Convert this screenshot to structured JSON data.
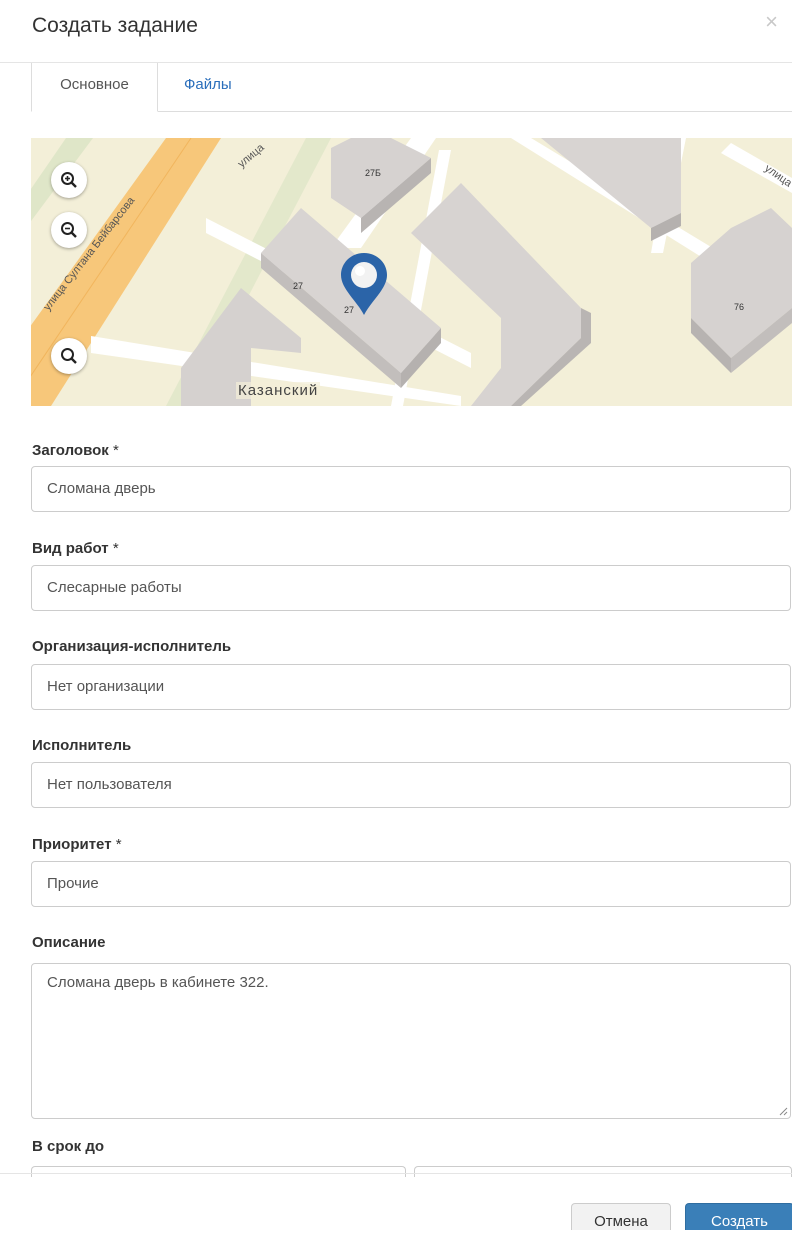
{
  "modal": {
    "title": "Создать задание",
    "close_glyph": "×"
  },
  "tabs": [
    {
      "label": "Основное"
    },
    {
      "label": "Файлы"
    }
  ],
  "map": {
    "road_label_1": "улица Султана Бейбарсова",
    "road_label_2": "улица",
    "road_label_3": "улица",
    "district_label": "Казанский",
    "house_numbers": [
      "27Б",
      "27",
      "27",
      "76"
    ],
    "controls": [
      "zoom-in-icon",
      "zoom-out-icon",
      "search-icon"
    ],
    "marker": "map-pin-icon"
  },
  "form": {
    "title": {
      "label": "Заголовок",
      "required": "*",
      "value": "Сломана дверь"
    },
    "work_type": {
      "label": "Вид работ",
      "required": "*",
      "value": "Слесарные работы"
    },
    "org": {
      "label": "Организация-исполнитель",
      "value": "Нет организации"
    },
    "executor": {
      "label": "Исполнитель",
      "value": "Нет пользователя"
    },
    "priority": {
      "label": "Приоритет",
      "required": "*",
      "value": "Прочие"
    },
    "description": {
      "label": "Описание",
      "value": "Сломана дверь в кабинете 322."
    },
    "deadline": {
      "label": "В срок до"
    }
  },
  "footer": {
    "cancel_label": "Отмена",
    "create_label": "Создать"
  },
  "colors": {
    "accent": "#3a7fb8",
    "link": "#2a6ebb",
    "marker": "#2b64a8"
  }
}
